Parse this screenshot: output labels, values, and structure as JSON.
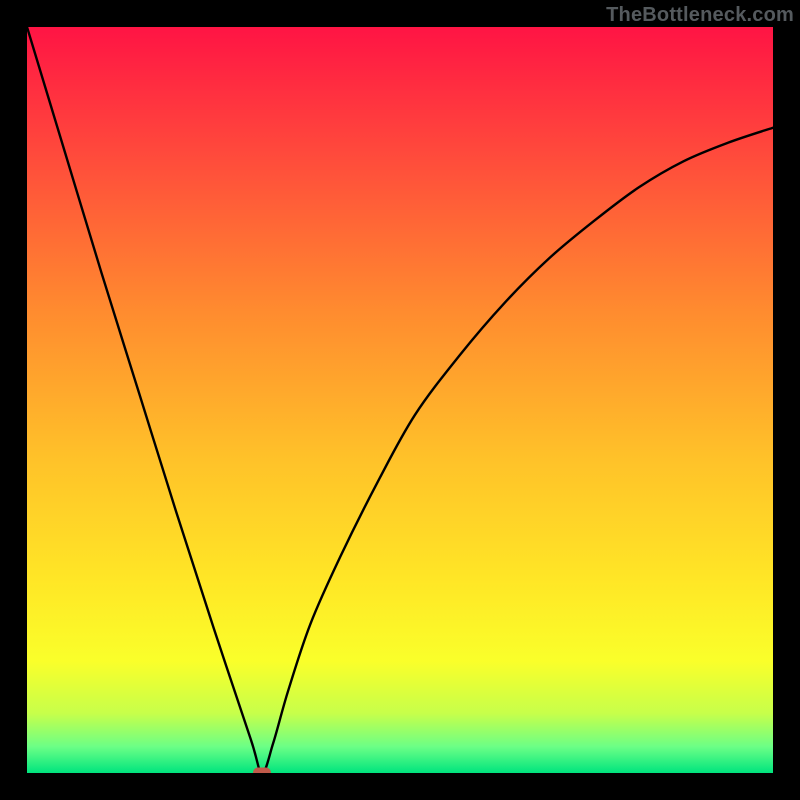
{
  "watermark": "TheBottleneck.com",
  "chart_data": {
    "type": "line",
    "title": "",
    "xlabel": "",
    "ylabel": "",
    "xlim": [
      0,
      100
    ],
    "ylim": [
      0,
      100
    ],
    "grid": false,
    "series": [
      {
        "name": "curve",
        "x": [
          0,
          5,
          10,
          15,
          20,
          25,
          30,
          31.5,
          33,
          35,
          38,
          42,
          47,
          52,
          58,
          64,
          70,
          76,
          82,
          88,
          94,
          100
        ],
        "values": [
          100,
          83.5,
          67,
          51,
          35,
          19.5,
          4.5,
          0,
          4,
          11,
          20,
          29,
          39,
          48,
          56,
          63,
          69,
          74,
          78.5,
          82,
          84.5,
          86.5
        ]
      }
    ],
    "marker": {
      "x": 31.5,
      "y": 0,
      "color": "#c05a4a",
      "shape": "pill"
    },
    "background_gradient": {
      "type": "vertical",
      "stops": [
        {
          "pos": 0.0,
          "color": "#ff1444"
        },
        {
          "pos": 0.18,
          "color": "#ff4d3b"
        },
        {
          "pos": 0.38,
          "color": "#ff8b2f"
        },
        {
          "pos": 0.58,
          "color": "#ffc229"
        },
        {
          "pos": 0.74,
          "color": "#ffe626"
        },
        {
          "pos": 0.85,
          "color": "#faff2a"
        },
        {
          "pos": 0.92,
          "color": "#c7ff4a"
        },
        {
          "pos": 0.965,
          "color": "#6bff86"
        },
        {
          "pos": 1.0,
          "color": "#00e47e"
        }
      ]
    }
  }
}
